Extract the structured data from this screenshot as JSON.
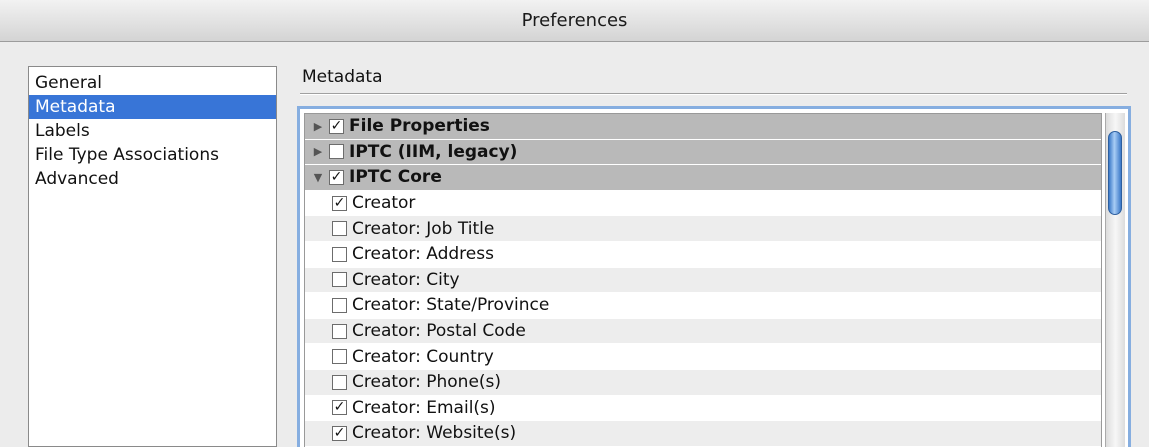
{
  "window": {
    "title": "Preferences"
  },
  "sidebar": {
    "items": [
      {
        "label": "General"
      },
      {
        "label": "Metadata",
        "selected": true
      },
      {
        "label": "Labels"
      },
      {
        "label": "File Type Associations"
      },
      {
        "label": "Advanced"
      }
    ]
  },
  "main": {
    "section_title": "Metadata",
    "groups": [
      {
        "label": "File Properties",
        "checked": true,
        "expanded": false
      },
      {
        "label": "IPTC (IIM, legacy)",
        "checked": false,
        "expanded": false
      },
      {
        "label": "IPTC Core",
        "checked": true,
        "expanded": true
      }
    ],
    "items": [
      {
        "label": "Creator",
        "checked": true
      },
      {
        "label": "Creator: Job Title",
        "checked": false
      },
      {
        "label": "Creator: Address",
        "checked": false
      },
      {
        "label": "Creator: City",
        "checked": false
      },
      {
        "label": "Creator: State/Province",
        "checked": false
      },
      {
        "label": "Creator: Postal Code",
        "checked": false
      },
      {
        "label": "Creator: Country",
        "checked": false
      },
      {
        "label": "Creator: Phone(s)",
        "checked": false
      },
      {
        "label": "Creator: Email(s)",
        "checked": true
      },
      {
        "label": "Creator: Website(s)",
        "checked": true
      }
    ]
  },
  "icons": {
    "collapsed": "disclosure-triangle-right",
    "expanded": "disclosure-triangle-down",
    "checkmark": "checkmark-icon"
  },
  "colors": {
    "selection": "#3875d7",
    "group_row": "#b9b9b9",
    "focus_ring": "#86aee0"
  }
}
